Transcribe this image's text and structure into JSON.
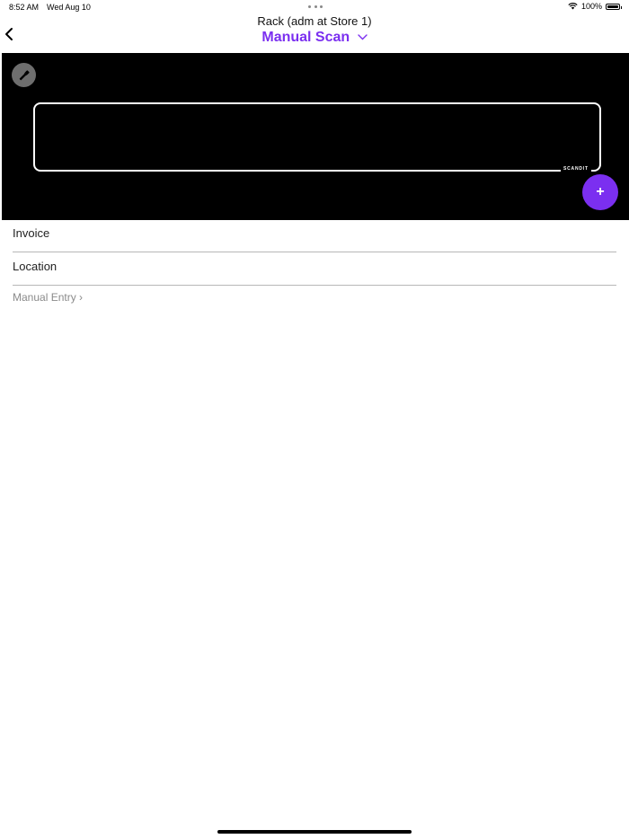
{
  "status_bar": {
    "time": "8:52 AM",
    "date": "Wed Aug 10",
    "battery_percent": "100%",
    "battery_level": 1.0,
    "wifi_icon": "wifi-icon"
  },
  "header": {
    "subtitle": "Rack (adm at Store 1)",
    "title": "Manual Scan",
    "back_icon": "chevron-left-icon",
    "dropdown_icon": "chevron-down-icon"
  },
  "scanner": {
    "brand_label": "SCANDIT",
    "flashlight_icon": "flashlight-icon",
    "add_button_label": "+"
  },
  "form": {
    "invoice_placeholder": "Invoice",
    "location_placeholder": "Location",
    "manual_entry_label": "Manual Entry ›"
  },
  "colors": {
    "accent": "#7b2ff0",
    "camera_background": "#000000",
    "divider": "#b7b7b7"
  }
}
